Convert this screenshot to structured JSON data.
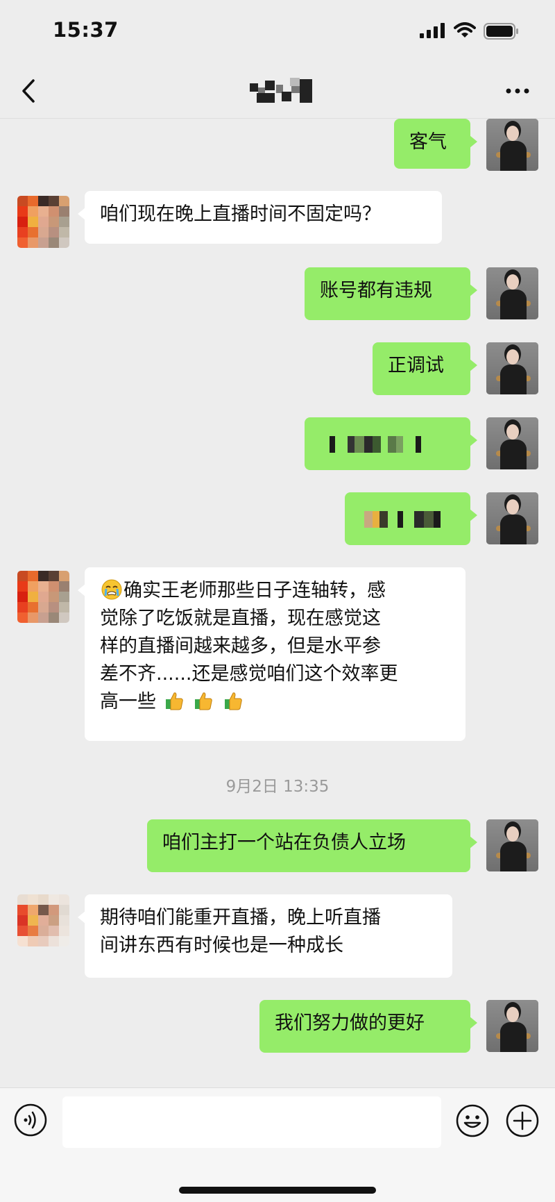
{
  "status_bar": {
    "time": "15:37"
  },
  "nav": {
    "title": ""
  },
  "messages": [
    {
      "side": "right",
      "text": "客气"
    },
    {
      "side": "left",
      "text": "咱们现在晚上直播时间不固定吗？"
    },
    {
      "side": "right",
      "text": "账号都有违规"
    },
    {
      "side": "right",
      "text": "正调试"
    },
    {
      "side": "right",
      "text": ""
    },
    {
      "side": "right",
      "text": ""
    },
    {
      "side": "left",
      "lines": [
        "确实王老师那些日子连轴转，感",
        "觉除了吃饭就是直播，现在感觉这",
        "样的直播间越来越多，但是水平参",
        "差不齐......还是感觉咱们这个效率更",
        "高一些"
      ]
    },
    {
      "side": "right",
      "text": "咱们主打一个站在负债人立场"
    },
    {
      "side": "left",
      "lines": [
        "期待咱们能重开直播，晚上听直播",
        "间讲东西有时候也是一种成长"
      ]
    },
    {
      "side": "right",
      "text": "我们努力做的更好"
    }
  ],
  "timestamp": "9月2日 13:35",
  "input": {
    "placeholder": ""
  },
  "icons": {
    "back": "chevron-left-icon",
    "more": "more-dots-icon",
    "voice": "voice-icon",
    "emoji": "smiley-icon",
    "plus": "plus-icon",
    "crying_emoji": "crying-face-icon",
    "thumbs": "thumbs-up-icon"
  },
  "colors": {
    "background": "#ededed",
    "self_bubble": "#95ec69",
    "other_bubble": "#ffffff"
  }
}
